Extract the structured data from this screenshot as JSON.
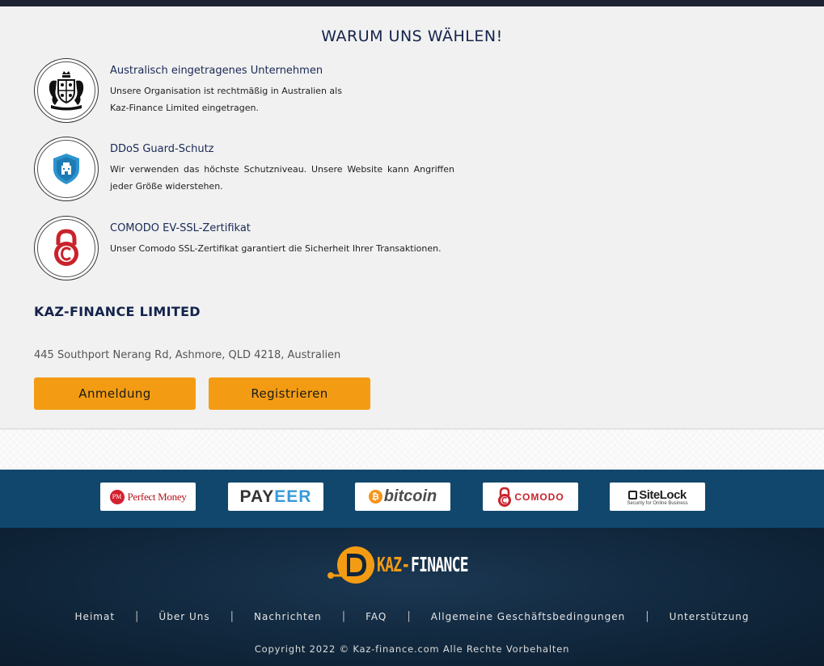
{
  "section": {
    "heading": "WARUM UNS WÄHLEN!",
    "features": [
      {
        "icon": "royal-coat-of-arms-icon",
        "title": "Australisch eingetragenes Unternehmen",
        "desc_line1": "Unsere Organisation ist rechtmäßig in Australien als",
        "desc_line2": "Kaz-Finance Limited eingetragen."
      },
      {
        "icon": "shield-icon",
        "title": "DDoS Guard-Schutz",
        "desc": "Wir verwenden das höchste Schutzniveau. Unsere Website kann Angriffen jeder Größe widerstehen."
      },
      {
        "icon": "padlock-icon",
        "title": "COMODO EV-SSL-Zertifikat",
        "desc": "Unser Comodo SSL-Zertifikat garantiert die Sicherheit Ihrer Transaktionen."
      }
    ]
  },
  "company": {
    "name": "KAZ-FINANCE LIMITED",
    "address": "445 Southport Nerang Rd, Ashmore, QLD 4218, Australien"
  },
  "buttons": {
    "login": "Anmeldung",
    "register": "Registrieren"
  },
  "payments": {
    "perfect_money": {
      "badge": "PM",
      "label": "Perfect Money"
    },
    "payeer": {
      "part1": "PAY",
      "part2": "EER"
    },
    "bitcoin": {
      "symbol": "₿",
      "label": "bitcoin"
    },
    "comodo": {
      "label": "COMODO"
    },
    "sitelock": {
      "label": "SiteLock",
      "tagline": "Security for Online Business"
    }
  },
  "footer": {
    "logo_part1": "KAZ-",
    "logo_part2": "FINANCE",
    "nav": [
      "Heimat",
      "Über Uns",
      "Nachrichten",
      "FAQ",
      "Allgemeine Geschäftsbedingungen",
      "Unterstützung"
    ],
    "separator": "|",
    "copyright": "Copyright 2022 © Kaz-finance.com Alle Rechte Vorbehalten"
  },
  "colors": {
    "accent": "#f39c13",
    "navy": "#14234b",
    "payments_bar": "#11476c",
    "footer_bg": "#10263b"
  }
}
